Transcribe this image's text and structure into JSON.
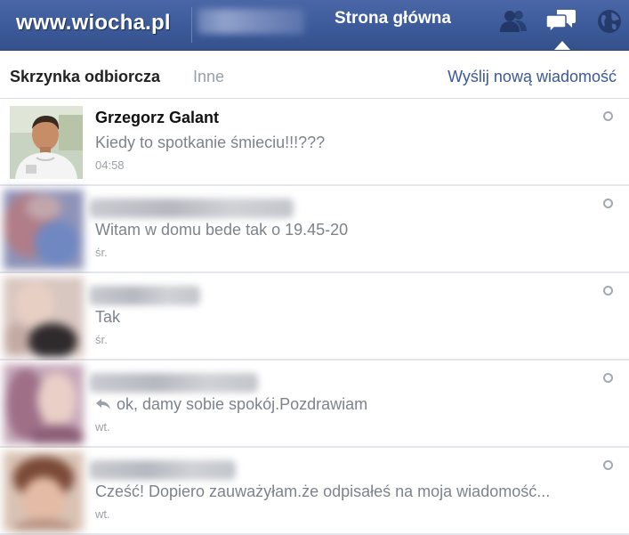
{
  "header": {
    "watermark": "www.wiocha.pl",
    "home_label": "Strona główna",
    "icons": [
      "friends-icon",
      "messages-icon",
      "globe-icon"
    ],
    "active_icon": "messages-icon"
  },
  "tabs": {
    "inbox": "Skrzynka odbiorcza",
    "other": "Inne",
    "new_message": "Wyślij nową wiadomość"
  },
  "messages": [
    {
      "name": "Grzegorz Galant",
      "preview": "Kiedy to spotkanie śmieciu!!!???",
      "time": "04:58",
      "name_blurred": false
    },
    {
      "name": "",
      "preview": "Witam w domu bede tak o 19.45-20",
      "time": "śr.",
      "name_blurred": true
    },
    {
      "name": "",
      "preview": "Tak",
      "time": "śr.",
      "name_blurred": true
    },
    {
      "name": "",
      "preview": "ok, damy sobie spokój.Pozdrawiam",
      "time": "wt.",
      "name_blurred": true,
      "replied": true
    },
    {
      "name": "",
      "preview": "Cześć! Dopiero zauważyłam.że odpisałeś na moja wiadomość...",
      "time": "wt.",
      "name_blurred": true
    }
  ],
  "colors": {
    "topbar": "#3b5998",
    "link": "#3b5998",
    "preview_text": "#7d838c"
  }
}
